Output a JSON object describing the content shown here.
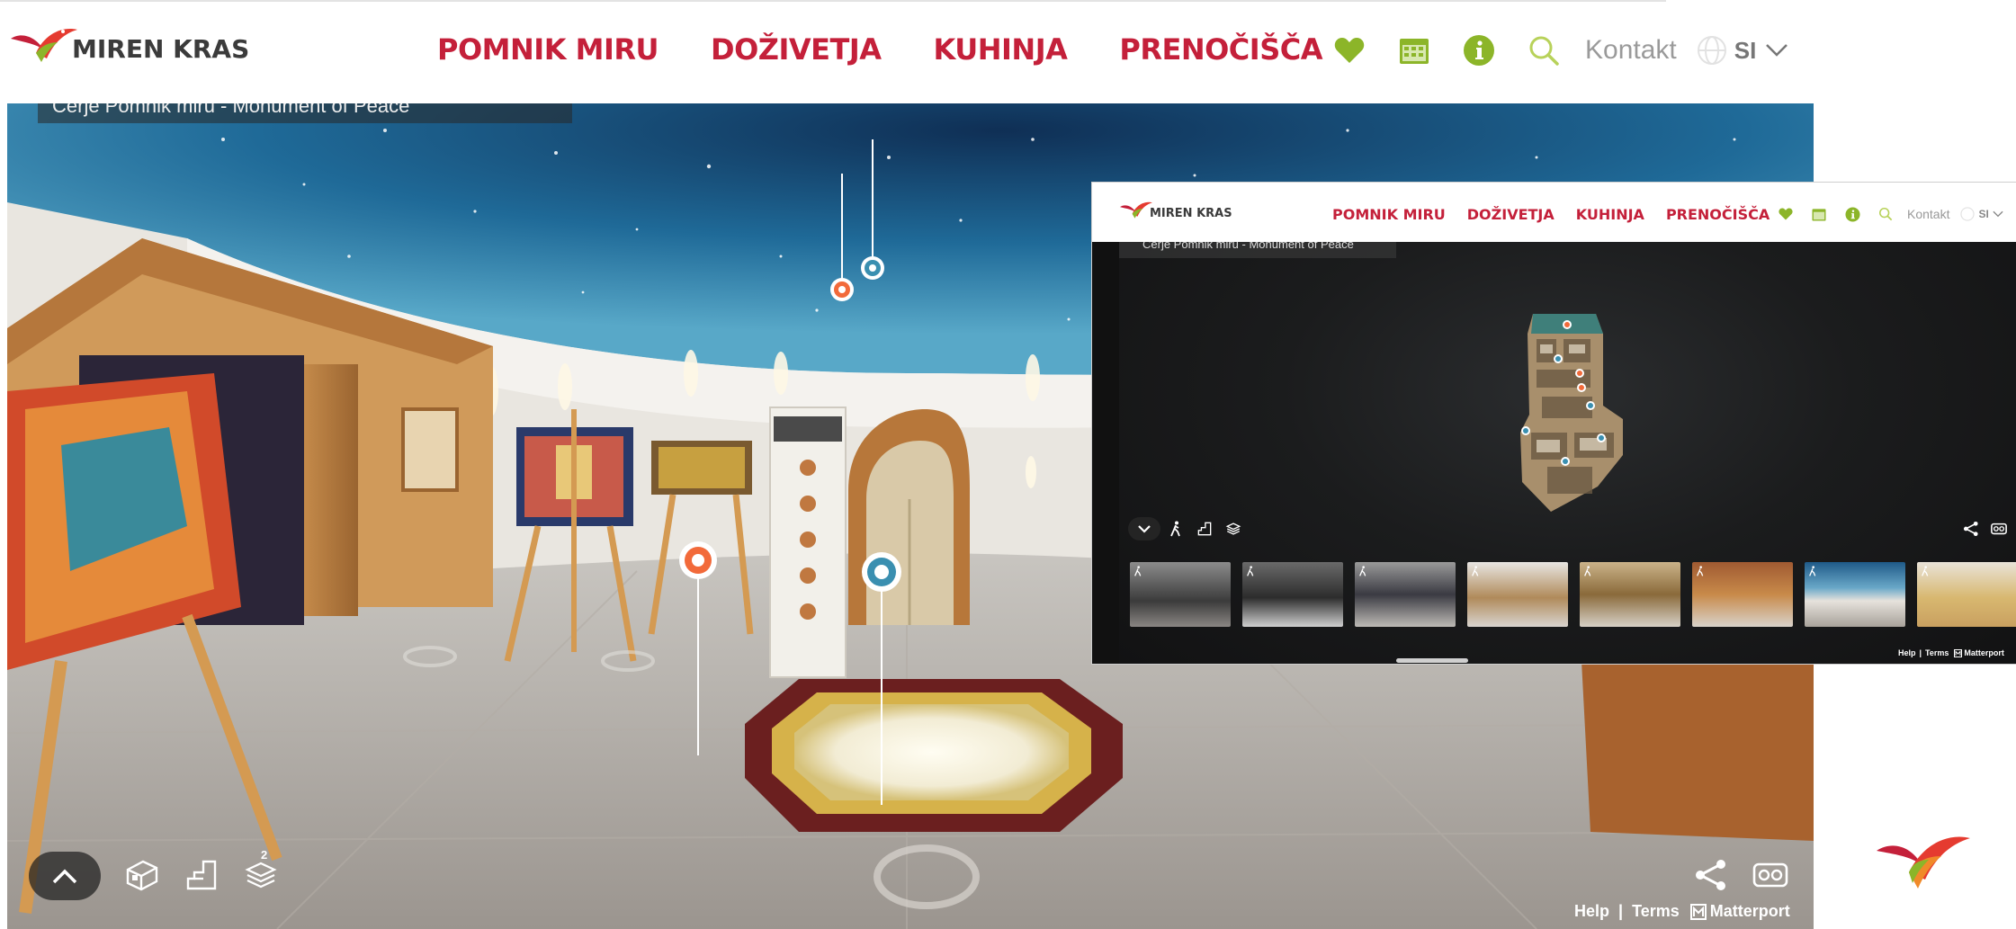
{
  "header": {
    "logo_text": "MIREN KRAS",
    "nav": [
      {
        "label": "POMNIK MIRU"
      },
      {
        "label": "DOŽIVETJA"
      },
      {
        "label": "KUHINJA"
      },
      {
        "label": "PRENOČIŠČA"
      }
    ],
    "icons": [
      "heart-icon",
      "calendar-icon",
      "info-icon",
      "search-icon"
    ],
    "contact_label": "Kontakt",
    "language": "SI"
  },
  "viewer": {
    "title": "Cerje Pomnik miru - Monument of Peace",
    "floor_badge": "2",
    "footer": {
      "help": "Help",
      "separator": "|",
      "terms": "Terms",
      "brand": "Matterport"
    }
  },
  "inset": {
    "logo_text": "MIREN KRAS",
    "nav": [
      {
        "label": "POMNIK MIRU"
      },
      {
        "label": "DOŽIVETJA"
      },
      {
        "label": "KUHINJA"
      },
      {
        "label": "PRENOČIŠČA"
      }
    ],
    "contact_label": "Kontakt",
    "language": "SI",
    "title": "Cerje Pomnik miru - Monument of Peace",
    "footer": {
      "help": "Help",
      "separator": "|",
      "terms": "Terms",
      "brand": "Matterport"
    },
    "thumbnails": 8
  },
  "colors": {
    "brand_red": "#c4203a",
    "brand_green": "#8cb529",
    "logo_dark": "#3b3b3b",
    "marker_orange": "#f26a3a",
    "marker_blue": "#3a8fb0"
  }
}
